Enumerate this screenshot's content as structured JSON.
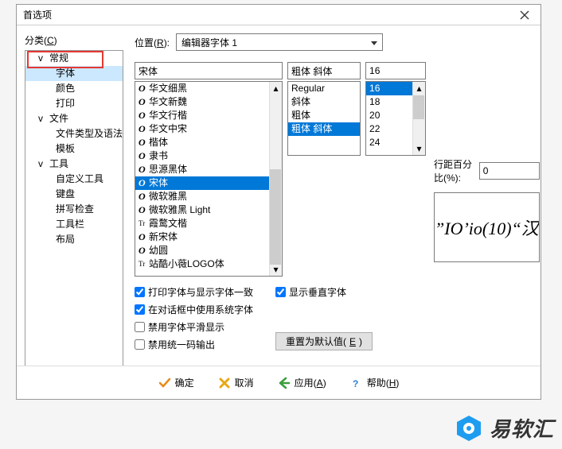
{
  "window": {
    "title": "首选项"
  },
  "sidebar": {
    "label_html": "分类(<u>C</u>)",
    "items": [
      {
        "label": "常规",
        "level": 1,
        "expander": "v",
        "highlighted": true
      },
      {
        "label": "字体",
        "level": 2,
        "selected": true
      },
      {
        "label": "颜色",
        "level": 2
      },
      {
        "label": "打印",
        "level": 2
      },
      {
        "label": "文件",
        "level": 1,
        "expander": "v"
      },
      {
        "label": "文件类型及语法",
        "level": 2
      },
      {
        "label": "模板",
        "level": 2
      },
      {
        "label": "工具",
        "level": 1,
        "expander": "v"
      },
      {
        "label": "自定义工具",
        "level": 2
      },
      {
        "label": "键盘",
        "level": 2
      },
      {
        "label": "拼写检查",
        "level": 2
      },
      {
        "label": "工具栏",
        "level": 2
      },
      {
        "label": "布局",
        "level": 2
      }
    ]
  },
  "main": {
    "position_label_html": "位置(<u>R</u>):",
    "position_value": "编辑器字体 1",
    "font_name_value": "宋体",
    "font_style_value": "粗体 斜体",
    "font_size_value": "16",
    "font_list": [
      {
        "icon": "O",
        "label": "华文细黑"
      },
      {
        "icon": "O",
        "label": "华文新魏"
      },
      {
        "icon": "O",
        "label": "华文行楷"
      },
      {
        "icon": "O",
        "label": "华文中宋"
      },
      {
        "icon": "O",
        "label": "楷体"
      },
      {
        "icon": "O",
        "label": "隶书"
      },
      {
        "icon": "O",
        "label": "思源黑体"
      },
      {
        "icon": "O",
        "label": "宋体",
        "selected": true
      },
      {
        "icon": "O",
        "label": "微软雅黑"
      },
      {
        "icon": "O",
        "label": "微软雅黑 Light"
      },
      {
        "icon": "T",
        "label": "霞鹜文楷"
      },
      {
        "icon": "O",
        "label": "新宋体"
      },
      {
        "icon": "O",
        "label": "幼圆"
      },
      {
        "icon": "T",
        "label": "站酷小薇LOGO体"
      }
    ],
    "style_list": [
      {
        "label": "Regular"
      },
      {
        "label": "斜体"
      },
      {
        "label": "粗体"
      },
      {
        "label": "粗体 斜体",
        "selected": true
      }
    ],
    "size_list": [
      {
        "label": "16",
        "selected": true
      },
      {
        "label": "18"
      },
      {
        "label": "20"
      },
      {
        "label": "22"
      },
      {
        "label": "24"
      }
    ],
    "spacing_label": "行距百分比(%):",
    "spacing_value": "0",
    "preview_text": "”IO’io(10)“汉",
    "checkboxes": {
      "same_font": {
        "label": "打印字体与显示字体一致",
        "checked": true
      },
      "system_font": {
        "label": "在对话框中使用系统字体",
        "checked": true
      },
      "no_smooth": {
        "label": "禁用字体平滑显示",
        "checked": false
      },
      "no_unicode": {
        "label": "禁用统一码输出",
        "checked": false
      },
      "vertical": {
        "label": "显示垂直字体",
        "checked": true
      }
    },
    "reset_html": "重置为默认值(<u>E</u>)"
  },
  "buttons": {
    "ok": "确定",
    "cancel": "取消",
    "apply_html": "应用(<u>A</u>)",
    "help_html": "帮助(<u>H</u>)"
  },
  "watermark": "易软汇"
}
